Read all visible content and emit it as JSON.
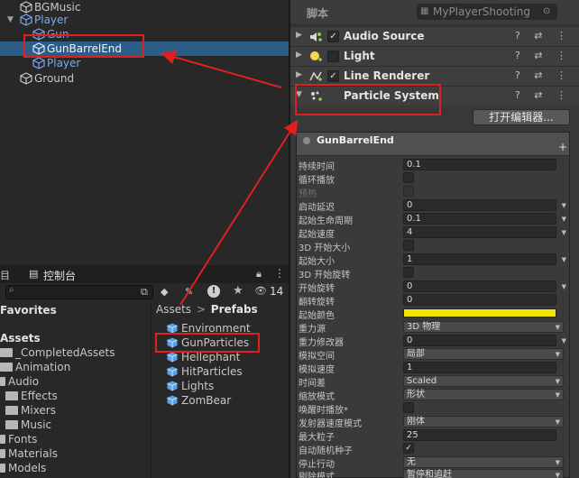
{
  "hierarchy": {
    "items": [
      {
        "label": "BGMusic"
      },
      {
        "label": "Player"
      },
      {
        "label": "Gun"
      },
      {
        "label": "GunBarrelEnd"
      },
      {
        "label": "Player"
      },
      {
        "label": "Ground"
      }
    ]
  },
  "project": {
    "tabs": [
      {
        "label": "目"
      },
      {
        "label": "控制台"
      }
    ],
    "toolbar": {
      "lock_count": "14"
    },
    "favorites_label": "Favorites",
    "tree": [
      {
        "label": "Assets"
      },
      {
        "label": "_CompletedAssets"
      },
      {
        "label": "Animation"
      },
      {
        "label": "Audio"
      },
      {
        "label": "Effects"
      },
      {
        "label": "Mixers"
      },
      {
        "label": "Music"
      },
      {
        "label": "Fonts"
      },
      {
        "label": "Materials"
      },
      {
        "label": "Models"
      }
    ],
    "breadcrumb": {
      "root": "Assets",
      "sep": ">",
      "current": "Prefabs"
    },
    "prefabs": [
      {
        "label": "Environment"
      },
      {
        "label": "GunParticles"
      },
      {
        "label": "Hellephant"
      },
      {
        "label": "HitParticles"
      },
      {
        "label": "Lights"
      },
      {
        "label": "ZomBear"
      }
    ]
  },
  "inspector": {
    "script_label": "脚本",
    "script_value": "MyPlayerShooting",
    "components": [
      {
        "label": "Audio Source",
        "checked": "✓"
      },
      {
        "label": "Light",
        "checked": ""
      },
      {
        "label": "Line Renderer",
        "checked": "✓"
      },
      {
        "label": "Particle System",
        "checked": ""
      }
    ],
    "component_tools": "? ⇄ ⋮",
    "open_editor": "打开编辑器...",
    "ps_title": "GunBarrelEnd",
    "ps_plus": "+",
    "props": [
      {
        "label": "持续时间",
        "value": "0.1"
      },
      {
        "label": "循环播放",
        "value": ""
      },
      {
        "label": "预热",
        "value": ""
      },
      {
        "label": "启动延迟",
        "value": "0"
      },
      {
        "label": "起始生命周期",
        "value": "0.1"
      },
      {
        "label": "起始速度",
        "value": "4"
      },
      {
        "label": "3D 开始大小",
        "value": ""
      },
      {
        "label": "起始大小",
        "value": "1"
      },
      {
        "label": "3D 开始旋转",
        "value": ""
      },
      {
        "label": "开始旋转",
        "value": "0"
      },
      {
        "label": "翻转旋转",
        "value": "0"
      },
      {
        "label": "起始颜色",
        "value": ""
      },
      {
        "label": "重力源",
        "value": "3D 物理"
      },
      {
        "label": "重力修改器",
        "value": "0"
      },
      {
        "label": "模拟空间",
        "value": "局部"
      },
      {
        "label": "模拟速度",
        "value": "1"
      },
      {
        "label": "时间差",
        "value": "Scaled"
      },
      {
        "label": "缩放模式",
        "value": "形状"
      },
      {
        "label": "唤醒时播放*",
        "value": ""
      },
      {
        "label": "发射器速度模式",
        "value": "刚体"
      },
      {
        "label": "最大粒子",
        "value": "25"
      },
      {
        "label": "自动随机种子",
        "value": "✓"
      },
      {
        "label": "停止行动",
        "value": "无"
      },
      {
        "label": "剔除模式",
        "value": "暂停和追赶"
      }
    ],
    "start_color": "#f2e400"
  }
}
